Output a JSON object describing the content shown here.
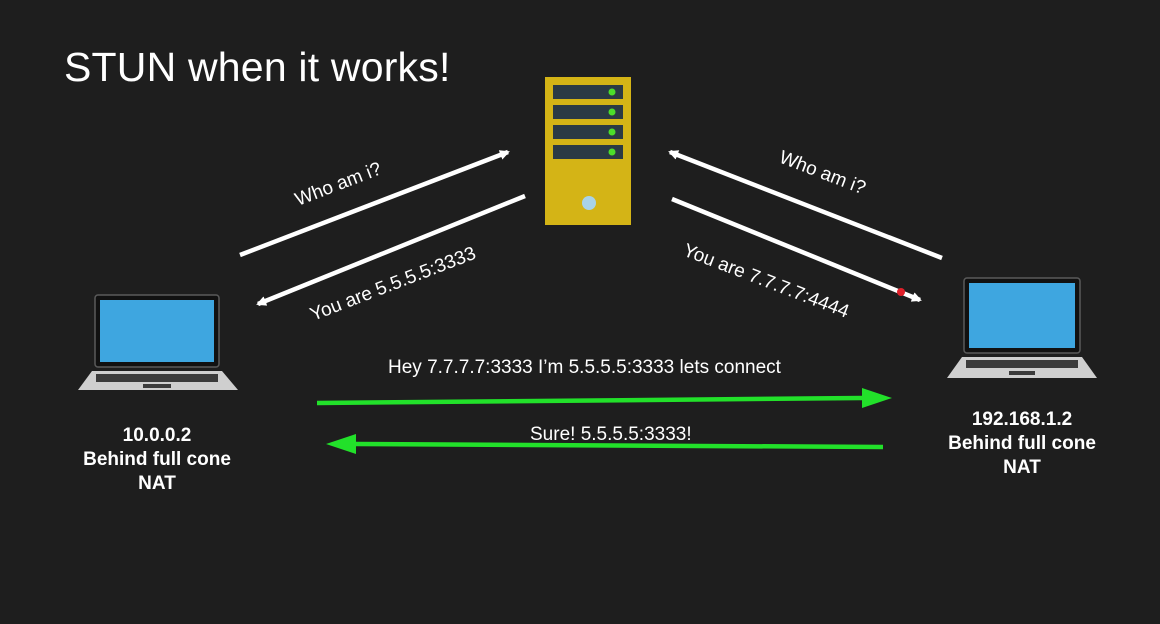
{
  "slide": {
    "title": "STUN when it works!"
  },
  "left_host": {
    "ip": "10.0.0.2",
    "nat_line1": "Behind full cone",
    "nat_line2": "NAT"
  },
  "right_host": {
    "ip": "192.168.1.2",
    "nat_line1": "Behind full cone",
    "nat_line2": "NAT"
  },
  "messages": {
    "left_request": "Who am i?",
    "left_response": "You are 5.5.5.5:3333",
    "right_request": "Who am i?",
    "right_response": "You are 7.7.7.7:4444",
    "p2p_request": "Hey 7.7.7.7:3333 I’m 5.5.5.5:3333 lets connect",
    "p2p_reply": "Sure! 5.5.5.5:3333!"
  },
  "colors": {
    "background": "#1e1e1e",
    "server_body": "#d4b416",
    "server_bay": "#2b3a44",
    "server_led": "#4cdd2a",
    "screen": "#3ea6e0",
    "p2p_arrow": "#22e12a",
    "stun_arrow": "#ffffff"
  }
}
